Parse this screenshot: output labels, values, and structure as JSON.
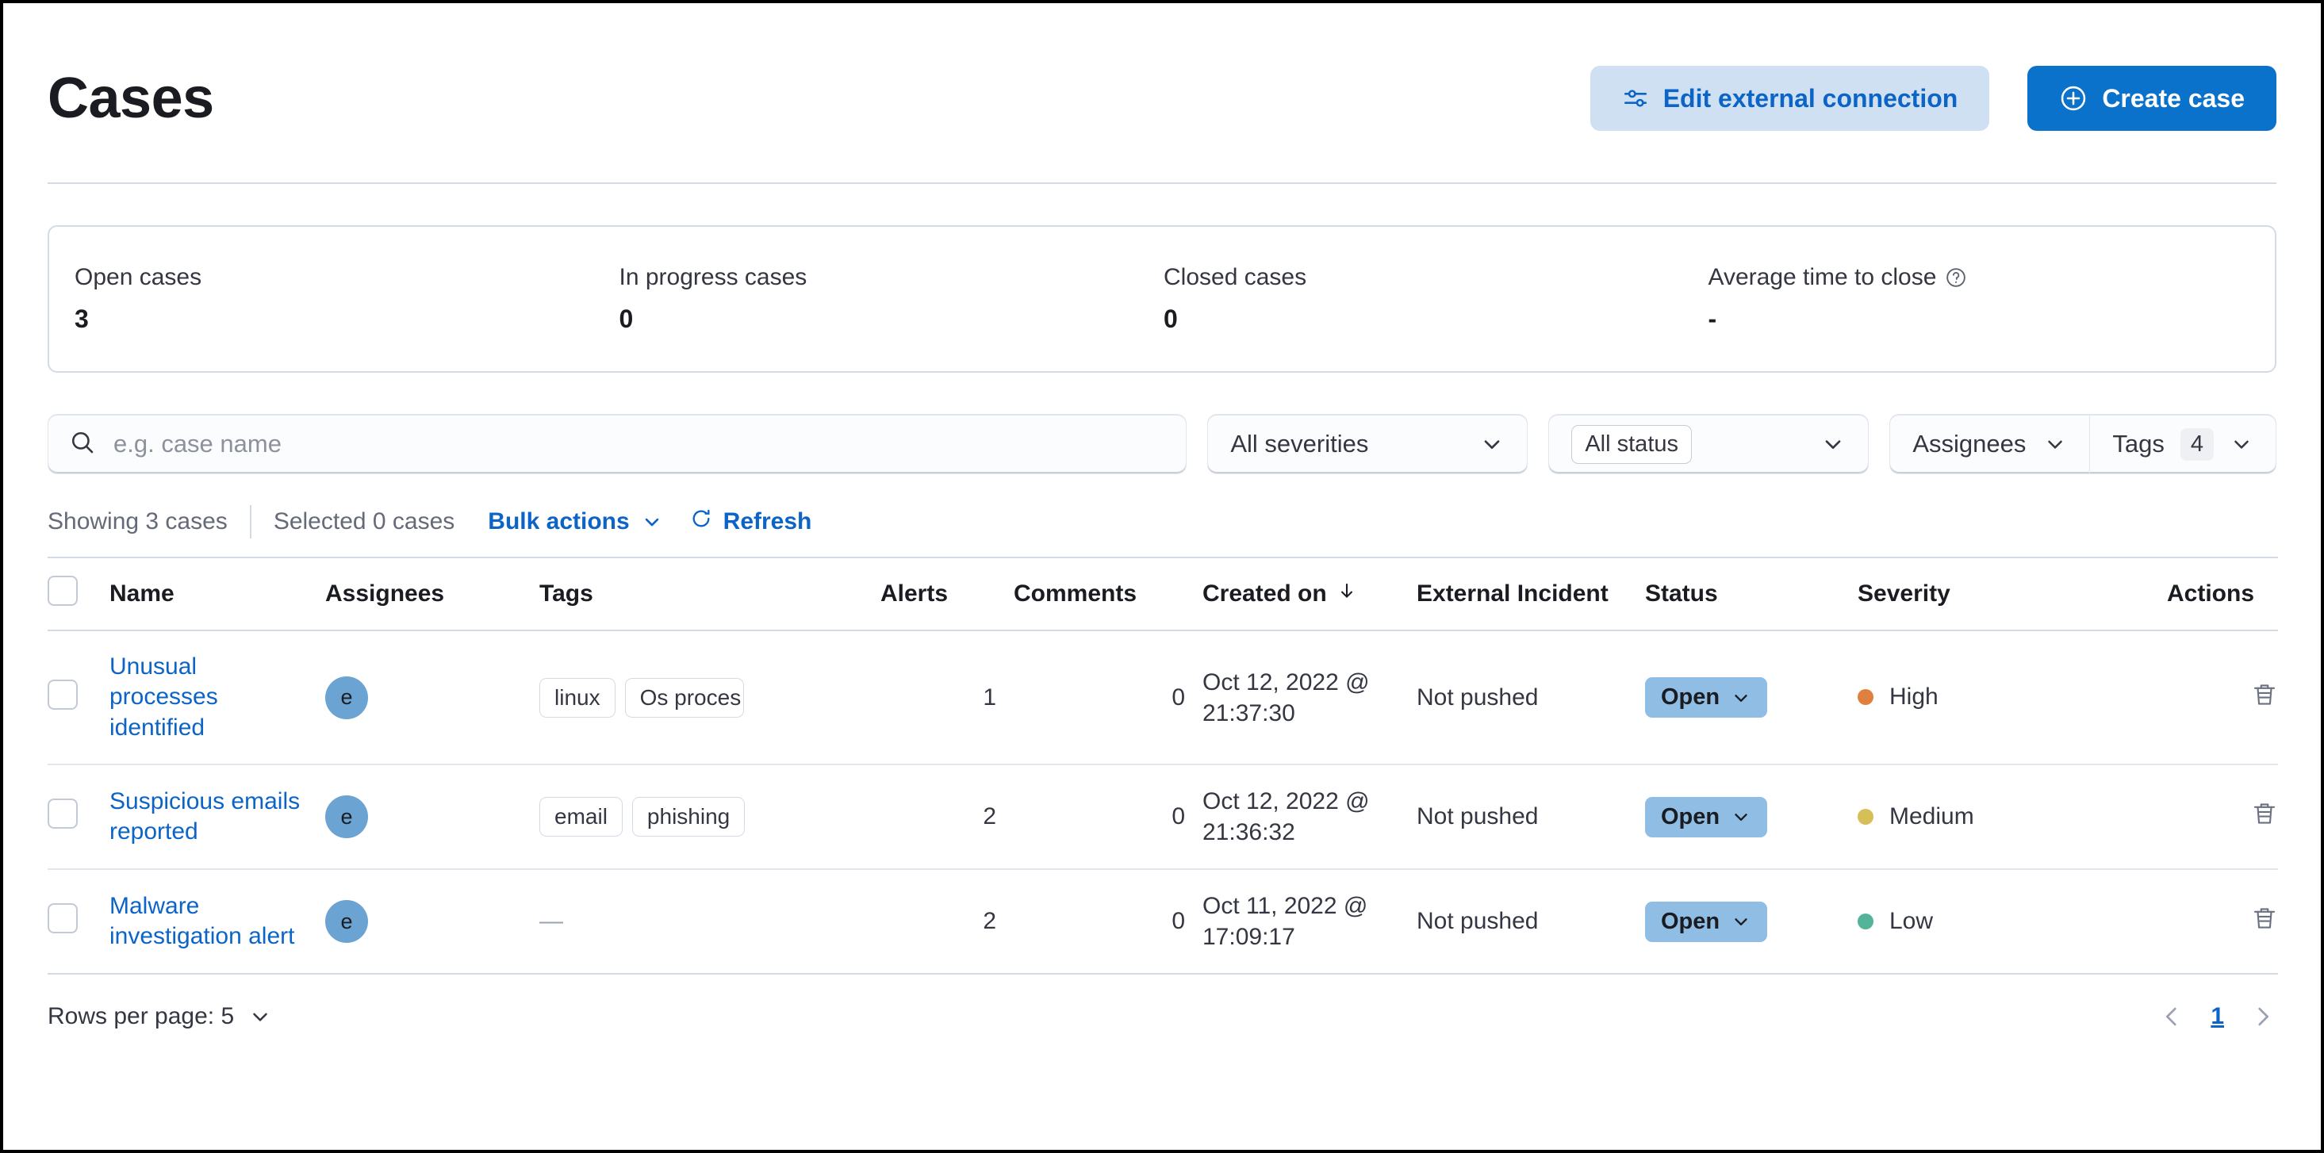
{
  "header": {
    "title": "Cases",
    "edit_connection_label": "Edit external connection",
    "create_case_label": "Create case"
  },
  "stats": [
    {
      "label": "Open cases",
      "value": "3"
    },
    {
      "label": "In progress cases",
      "value": "0"
    },
    {
      "label": "Closed cases",
      "value": "0"
    },
    {
      "label": "Average time to close",
      "value": "-",
      "has_help": true
    }
  ],
  "filters": {
    "search_placeholder": "e.g. case name",
    "search_value": "",
    "severity_label": "All severities",
    "status_label": "All status",
    "assignees_label": "Assignees",
    "tags_label": "Tags",
    "tags_count": "4"
  },
  "toolbar": {
    "showing": "Showing 3 cases",
    "selected": "Selected 0 cases",
    "bulk_actions": "Bulk actions",
    "refresh": "Refresh"
  },
  "table": {
    "columns": {
      "name": "Name",
      "assignees": "Assignees",
      "tags": "Tags",
      "alerts": "Alerts",
      "comments": "Comments",
      "created_on": "Created on",
      "external_incident": "External Incident",
      "status": "Status",
      "severity": "Severity",
      "actions": "Actions"
    },
    "sort": {
      "column": "Created on",
      "direction": "desc"
    },
    "rows": [
      {
        "name": "Unusual processes identified",
        "assignee_initial": "e",
        "tags": [
          "linux",
          "Os proces"
        ],
        "alerts": "1",
        "comments": "0",
        "created_date": "Oct 12, 2022 @",
        "created_time": "21:37:30",
        "external_incident": "Not pushed",
        "status": "Open",
        "severity": "High",
        "severity_color": "#e08040"
      },
      {
        "name": "Suspicious emails reported",
        "assignee_initial": "e",
        "tags": [
          "email",
          "phishing"
        ],
        "alerts": "2",
        "comments": "0",
        "created_date": "Oct 12, 2022 @",
        "created_time": "21:36:32",
        "external_incident": "Not pushed",
        "status": "Open",
        "severity": "Medium",
        "severity_color": "#d6bf57"
      },
      {
        "name": "Malware investigation alert",
        "assignee_initial": "e",
        "tags": [],
        "empty_tags": "—",
        "alerts": "2",
        "comments": "0",
        "created_date": "Oct 11, 2022 @",
        "created_time": "17:09:17",
        "external_incident": "Not pushed",
        "status": "Open",
        "severity": "Low",
        "severity_color": "#54b399"
      }
    ]
  },
  "footer": {
    "rows_per_page_label": "Rows per page: 5",
    "current_page": "1"
  },
  "colors": {
    "accent": "#0b64c6",
    "primary_button": "#0b72cb",
    "secondary_button": "#cfe0f2",
    "status_badge": "#8fbde4",
    "avatar": "#6ba3d2",
    "severity_high": "#e08040",
    "severity_medium": "#d6bf57",
    "severity_low": "#54b399"
  }
}
